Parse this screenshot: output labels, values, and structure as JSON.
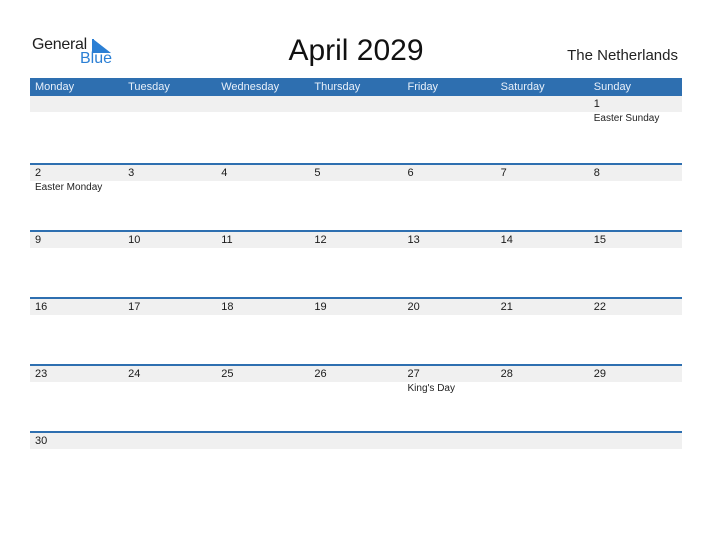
{
  "logo": {
    "word1": "General",
    "word2": "Blue"
  },
  "title": "April 2029",
  "country": "The Netherlands",
  "colors": {
    "accent": "#2e6fb0",
    "band": "#f0f0f0",
    "logo_blue": "#2b7fd4"
  },
  "weekdays": [
    "Monday",
    "Tuesday",
    "Wednesday",
    "Thursday",
    "Friday",
    "Saturday",
    "Sunday"
  ],
  "weeks": [
    [
      {
        "day": "",
        "holiday": ""
      },
      {
        "day": "",
        "holiday": ""
      },
      {
        "day": "",
        "holiday": ""
      },
      {
        "day": "",
        "holiday": ""
      },
      {
        "day": "",
        "holiday": ""
      },
      {
        "day": "",
        "holiday": ""
      },
      {
        "day": "1",
        "holiday": "Easter Sunday"
      }
    ],
    [
      {
        "day": "2",
        "holiday": "Easter Monday"
      },
      {
        "day": "3",
        "holiday": ""
      },
      {
        "day": "4",
        "holiday": ""
      },
      {
        "day": "5",
        "holiday": ""
      },
      {
        "day": "6",
        "holiday": ""
      },
      {
        "day": "7",
        "holiday": ""
      },
      {
        "day": "8",
        "holiday": ""
      }
    ],
    [
      {
        "day": "9",
        "holiday": ""
      },
      {
        "day": "10",
        "holiday": ""
      },
      {
        "day": "11",
        "holiday": ""
      },
      {
        "day": "12",
        "holiday": ""
      },
      {
        "day": "13",
        "holiday": ""
      },
      {
        "day": "14",
        "holiday": ""
      },
      {
        "day": "15",
        "holiday": ""
      }
    ],
    [
      {
        "day": "16",
        "holiday": ""
      },
      {
        "day": "17",
        "holiday": ""
      },
      {
        "day": "18",
        "holiday": ""
      },
      {
        "day": "19",
        "holiday": ""
      },
      {
        "day": "20",
        "holiday": ""
      },
      {
        "day": "21",
        "holiday": ""
      },
      {
        "day": "22",
        "holiday": ""
      }
    ],
    [
      {
        "day": "23",
        "holiday": ""
      },
      {
        "day": "24",
        "holiday": ""
      },
      {
        "day": "25",
        "holiday": ""
      },
      {
        "day": "26",
        "holiday": ""
      },
      {
        "day": "27",
        "holiday": "King's Day"
      },
      {
        "day": "28",
        "holiday": ""
      },
      {
        "day": "29",
        "holiday": ""
      }
    ],
    [
      {
        "day": "30",
        "holiday": ""
      },
      {
        "day": "",
        "holiday": ""
      },
      {
        "day": "",
        "holiday": ""
      },
      {
        "day": "",
        "holiday": ""
      },
      {
        "day": "",
        "holiday": ""
      },
      {
        "day": "",
        "holiday": ""
      },
      {
        "day": "",
        "holiday": ""
      }
    ]
  ]
}
